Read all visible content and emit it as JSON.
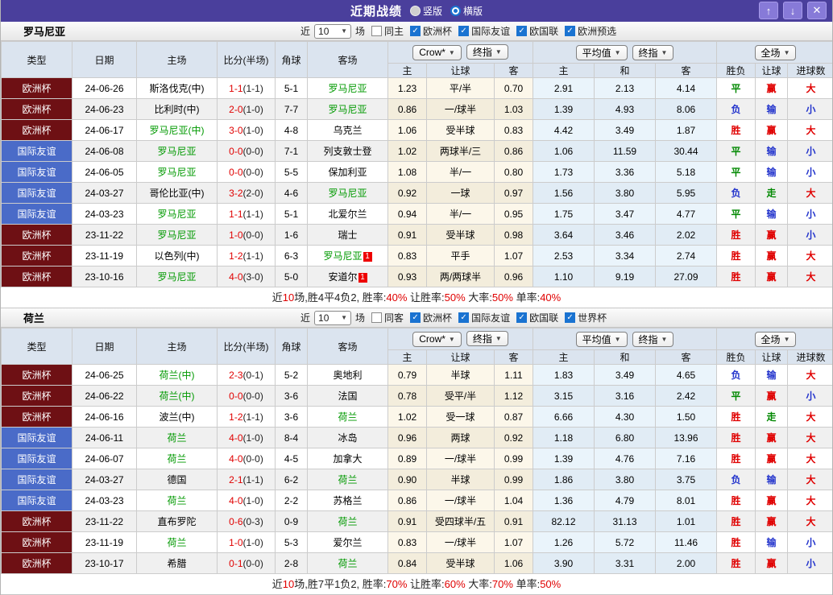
{
  "titlebar": {
    "title": "近期战绩",
    "radios": [
      {
        "label": "竖版",
        "selected": false
      },
      {
        "label": "横版",
        "selected": true
      }
    ],
    "buttons": {
      "up": "↑",
      "down": "↓",
      "close": "✕"
    }
  },
  "colors": {
    "titlebar_bg": "#4a3f9c",
    "type_euro_bg": "#6e1014",
    "type_friendly_bg": "#4a6bc8",
    "team_highlight_green": "#009900",
    "score_red": "#e00000",
    "win_red": "#e00000",
    "draw_green": "#008800",
    "lose_blue": "#2233cc",
    "crow_columns_bg": "#fcf7ea",
    "average_columns_bg": "#eaf4fb",
    "checkbox_blue": "#1a73d1"
  },
  "table_header": {
    "static_cols": [
      "类型",
      "日期",
      "主场",
      "比分(半场)",
      "角球",
      "客场"
    ],
    "odds_dropdowns": [
      "Crow*",
      "终指"
    ],
    "avg_dropdowns": [
      "平均值",
      "终指"
    ],
    "scope_dropdown": "全场",
    "sub_cols": [
      "主",
      "让球",
      "客",
      "主",
      "和",
      "客",
      "胜负",
      "让球",
      "进球数"
    ]
  },
  "sections": [
    {
      "team": "罗马尼亚",
      "filter": {
        "prefix": "近",
        "count": "10",
        "suffix": "场",
        "same": {
          "label": "同主",
          "checked": false
        },
        "leagues": [
          {
            "label": "欧洲杯",
            "checked": true
          },
          {
            "label": "国际友谊",
            "checked": true
          },
          {
            "label": "欧国联",
            "checked": true
          },
          {
            "label": "欧洲预选",
            "checked": true
          }
        ]
      },
      "rows": [
        {
          "type": "欧洲杯",
          "tk": "euro",
          "date": "24-06-26",
          "home": "斯洛伐克(中)",
          "hg": false,
          "hrc": "",
          "ft": "1-1",
          "ht": "(1-1)",
          "cor": "5-1",
          "away": "罗马尼亚",
          "ag": true,
          "arc": "",
          "o1": "1.23",
          "line": "平/半",
          "o2": "0.70",
          "a1": "2.91",
          "a2": "2.13",
          "a3": "4.14",
          "r1": "平",
          "c1": "g",
          "r2": "赢",
          "c2": "r",
          "r3": "大",
          "c3": "r"
        },
        {
          "type": "欧洲杯",
          "tk": "euro",
          "date": "24-06-23",
          "home": "比利时(中)",
          "hg": false,
          "hrc": "",
          "ft": "2-0",
          "ht": "(1-0)",
          "cor": "7-7",
          "away": "罗马尼亚",
          "ag": true,
          "arc": "",
          "o1": "0.86",
          "line": "一/球半",
          "o2": "1.03",
          "a1": "1.39",
          "a2": "4.93",
          "a3": "8.06",
          "r1": "负",
          "c1": "b",
          "r2": "输",
          "c2": "b",
          "r3": "小",
          "c3": "b"
        },
        {
          "type": "欧洲杯",
          "tk": "euro",
          "date": "24-06-17",
          "home": "罗马尼亚(中)",
          "hg": true,
          "hrc": "",
          "ft": "3-0",
          "ht": "(1-0)",
          "cor": "4-8",
          "away": "乌克兰",
          "ag": false,
          "arc": "",
          "o1": "1.06",
          "line": "受半球",
          "o2": "0.83",
          "a1": "4.42",
          "a2": "3.49",
          "a3": "1.87",
          "r1": "胜",
          "c1": "r",
          "r2": "赢",
          "c2": "r",
          "r3": "大",
          "c3": "r"
        },
        {
          "type": "国际友谊",
          "tk": "friendly",
          "date": "24-06-08",
          "home": "罗马尼亚",
          "hg": true,
          "hrc": "",
          "ft": "0-0",
          "ht": "(0-0)",
          "cor": "7-1",
          "away": "列支敦士登",
          "ag": false,
          "arc": "",
          "o1": "1.02",
          "line": "两球半/三",
          "o2": "0.86",
          "a1": "1.06",
          "a2": "11.59",
          "a3": "30.44",
          "r1": "平",
          "c1": "g",
          "r2": "输",
          "c2": "b",
          "r3": "小",
          "c3": "b"
        },
        {
          "type": "国际友谊",
          "tk": "friendly",
          "date": "24-06-05",
          "home": "罗马尼亚",
          "hg": true,
          "hrc": "",
          "ft": "0-0",
          "ht": "(0-0)",
          "cor": "5-5",
          "away": "保加利亚",
          "ag": false,
          "arc": "",
          "o1": "1.08",
          "line": "半/一",
          "o2": "0.80",
          "a1": "1.73",
          "a2": "3.36",
          "a3": "5.18",
          "r1": "平",
          "c1": "g",
          "r2": "输",
          "c2": "b",
          "r3": "小",
          "c3": "b"
        },
        {
          "type": "国际友谊",
          "tk": "friendly",
          "date": "24-03-27",
          "home": "哥伦比亚(中)",
          "hg": false,
          "hrc": "",
          "ft": "3-2",
          "ht": "(2-0)",
          "cor": "4-6",
          "away": "罗马尼亚",
          "ag": true,
          "arc": "",
          "o1": "0.92",
          "line": "一球",
          "o2": "0.97",
          "a1": "1.56",
          "a2": "3.80",
          "a3": "5.95",
          "r1": "负",
          "c1": "b",
          "r2": "走",
          "c2": "g",
          "r3": "大",
          "c3": "r"
        },
        {
          "type": "国际友谊",
          "tk": "friendly",
          "date": "24-03-23",
          "home": "罗马尼亚",
          "hg": true,
          "hrc": "",
          "ft": "1-1",
          "ht": "(1-1)",
          "cor": "5-1",
          "away": "北爱尔兰",
          "ag": false,
          "arc": "",
          "o1": "0.94",
          "line": "半/一",
          "o2": "0.95",
          "a1": "1.75",
          "a2": "3.47",
          "a3": "4.77",
          "r1": "平",
          "c1": "g",
          "r2": "输",
          "c2": "b",
          "r3": "小",
          "c3": "b"
        },
        {
          "type": "欧洲杯",
          "tk": "euro",
          "date": "23-11-22",
          "home": "罗马尼亚",
          "hg": true,
          "hrc": "",
          "ft": "1-0",
          "ht": "(0-0)",
          "cor": "1-6",
          "away": "瑞士",
          "ag": false,
          "arc": "",
          "o1": "0.91",
          "line": "受半球",
          "o2": "0.98",
          "a1": "3.64",
          "a2": "3.46",
          "a3": "2.02",
          "r1": "胜",
          "c1": "r",
          "r2": "赢",
          "c2": "r",
          "r3": "小",
          "c3": "b"
        },
        {
          "type": "欧洲杯",
          "tk": "euro",
          "date": "23-11-19",
          "home": "以色列(中)",
          "hg": false,
          "hrc": "",
          "ft": "1-2",
          "ht": "(1-1)",
          "cor": "6-3",
          "away": "罗马尼亚",
          "ag": true,
          "arc": "1",
          "o1": "0.83",
          "line": "平手",
          "o2": "1.07",
          "a1": "2.53",
          "a2": "3.34",
          "a3": "2.74",
          "r1": "胜",
          "c1": "r",
          "r2": "赢",
          "c2": "r",
          "r3": "大",
          "c3": "r"
        },
        {
          "type": "欧洲杯",
          "tk": "euro",
          "date": "23-10-16",
          "home": "罗马尼亚",
          "hg": true,
          "hrc": "",
          "ft": "4-0",
          "ht": "(3-0)",
          "cor": "5-0",
          "away": "安道尔",
          "ag": false,
          "arc": "1",
          "o1": "0.93",
          "line": "两/两球半",
          "o2": "0.96",
          "a1": "1.10",
          "a2": "9.19",
          "a3": "27.09",
          "r1": "胜",
          "c1": "r",
          "r2": "赢",
          "c2": "r",
          "r3": "大",
          "c3": "r"
        }
      ],
      "summary": [
        {
          "t": "近"
        },
        {
          "t": "10",
          "red": true
        },
        {
          "t": "场,胜4平4负2, 胜率:"
        },
        {
          "t": "40%",
          "red": true
        },
        {
          "t": " 让胜率:"
        },
        {
          "t": "50%",
          "red": true
        },
        {
          "t": " 大率:"
        },
        {
          "t": "50%",
          "red": true
        },
        {
          "t": " 单率:"
        },
        {
          "t": "40%",
          "red": true
        }
      ]
    },
    {
      "team": "荷兰",
      "filter": {
        "prefix": "近",
        "count": "10",
        "suffix": "场",
        "same": {
          "label": "同客",
          "checked": false
        },
        "leagues": [
          {
            "label": "欧洲杯",
            "checked": true
          },
          {
            "label": "国际友谊",
            "checked": true
          },
          {
            "label": "欧国联",
            "checked": true
          },
          {
            "label": "世界杯",
            "checked": true
          }
        ]
      },
      "rows": [
        {
          "type": "欧洲杯",
          "tk": "euro",
          "date": "24-06-25",
          "home": "荷兰(中)",
          "hg": true,
          "hrc": "",
          "ft": "2-3",
          "ht": "(0-1)",
          "cor": "5-2",
          "away": "奥地利",
          "ag": false,
          "arc": "",
          "o1": "0.79",
          "line": "半球",
          "o2": "1.11",
          "a1": "1.83",
          "a2": "3.49",
          "a3": "4.65",
          "r1": "负",
          "c1": "b",
          "r2": "输",
          "c2": "b",
          "r3": "大",
          "c3": "r"
        },
        {
          "type": "欧洲杯",
          "tk": "euro",
          "date": "24-06-22",
          "home": "荷兰(中)",
          "hg": true,
          "hrc": "",
          "ft": "0-0",
          "ht": "(0-0)",
          "cor": "3-6",
          "away": "法国",
          "ag": false,
          "arc": "",
          "o1": "0.78",
          "line": "受平/半",
          "o2": "1.12",
          "a1": "3.15",
          "a2": "3.16",
          "a3": "2.42",
          "r1": "平",
          "c1": "g",
          "r2": "赢",
          "c2": "r",
          "r3": "小",
          "c3": "b"
        },
        {
          "type": "欧洲杯",
          "tk": "euro",
          "date": "24-06-16",
          "home": "波兰(中)",
          "hg": false,
          "hrc": "",
          "ft": "1-2",
          "ht": "(1-1)",
          "cor": "3-6",
          "away": "荷兰",
          "ag": true,
          "arc": "",
          "o1": "1.02",
          "line": "受一球",
          "o2": "0.87",
          "a1": "6.66",
          "a2": "4.30",
          "a3": "1.50",
          "r1": "胜",
          "c1": "r",
          "r2": "走",
          "c2": "g",
          "r3": "大",
          "c3": "r"
        },
        {
          "type": "国际友谊",
          "tk": "friendly",
          "date": "24-06-11",
          "home": "荷兰",
          "hg": true,
          "hrc": "",
          "ft": "4-0",
          "ht": "(1-0)",
          "cor": "8-4",
          "away": "冰岛",
          "ag": false,
          "arc": "",
          "o1": "0.96",
          "line": "两球",
          "o2": "0.92",
          "a1": "1.18",
          "a2": "6.80",
          "a3": "13.96",
          "r1": "胜",
          "c1": "r",
          "r2": "赢",
          "c2": "r",
          "r3": "大",
          "c3": "r"
        },
        {
          "type": "国际友谊",
          "tk": "friendly",
          "date": "24-06-07",
          "home": "荷兰",
          "hg": true,
          "hrc": "",
          "ft": "4-0",
          "ht": "(0-0)",
          "cor": "4-5",
          "away": "加拿大",
          "ag": false,
          "arc": "",
          "o1": "0.89",
          "line": "一/球半",
          "o2": "0.99",
          "a1": "1.39",
          "a2": "4.76",
          "a3": "7.16",
          "r1": "胜",
          "c1": "r",
          "r2": "赢",
          "c2": "r",
          "r3": "大",
          "c3": "r"
        },
        {
          "type": "国际友谊",
          "tk": "friendly",
          "date": "24-03-27",
          "home": "德国",
          "hg": false,
          "hrc": "",
          "ft": "2-1",
          "ht": "(1-1)",
          "cor": "6-2",
          "away": "荷兰",
          "ag": true,
          "arc": "",
          "o1": "0.90",
          "line": "半球",
          "o2": "0.99",
          "a1": "1.86",
          "a2": "3.80",
          "a3": "3.75",
          "r1": "负",
          "c1": "b",
          "r2": "输",
          "c2": "b",
          "r3": "大",
          "c3": "r"
        },
        {
          "type": "国际友谊",
          "tk": "friendly",
          "date": "24-03-23",
          "home": "荷兰",
          "hg": true,
          "hrc": "",
          "ft": "4-0",
          "ht": "(1-0)",
          "cor": "2-2",
          "away": "苏格兰",
          "ag": false,
          "arc": "",
          "o1": "0.86",
          "line": "一/球半",
          "o2": "1.04",
          "a1": "1.36",
          "a2": "4.79",
          "a3": "8.01",
          "r1": "胜",
          "c1": "r",
          "r2": "赢",
          "c2": "r",
          "r3": "大",
          "c3": "r"
        },
        {
          "type": "欧洲杯",
          "tk": "euro",
          "date": "23-11-22",
          "home": "直布罗陀",
          "hg": false,
          "hrc": "",
          "ft": "0-6",
          "ht": "(0-3)",
          "cor": "0-9",
          "away": "荷兰",
          "ag": true,
          "arc": "",
          "o1": "0.91",
          "line": "受四球半/五",
          "o2": "0.91",
          "a1": "82.12",
          "a2": "31.13",
          "a3": "1.01",
          "r1": "胜",
          "c1": "r",
          "r2": "赢",
          "c2": "r",
          "r3": "大",
          "c3": "r"
        },
        {
          "type": "欧洲杯",
          "tk": "euro",
          "date": "23-11-19",
          "home": "荷兰",
          "hg": true,
          "hrc": "",
          "ft": "1-0",
          "ht": "(1-0)",
          "cor": "5-3",
          "away": "爱尔兰",
          "ag": false,
          "arc": "",
          "o1": "0.83",
          "line": "一/球半",
          "o2": "1.07",
          "a1": "1.26",
          "a2": "5.72",
          "a3": "11.46",
          "r1": "胜",
          "c1": "r",
          "r2": "输",
          "c2": "b",
          "r3": "小",
          "c3": "b"
        },
        {
          "type": "欧洲杯",
          "tk": "euro",
          "date": "23-10-17",
          "home": "希腊",
          "hg": false,
          "hrc": "",
          "ft": "0-1",
          "ht": "(0-0)",
          "cor": "2-8",
          "away": "荷兰",
          "ag": true,
          "arc": "",
          "o1": "0.84",
          "line": "受半球",
          "o2": "1.06",
          "a1": "3.90",
          "a2": "3.31",
          "a3": "2.00",
          "r1": "胜",
          "c1": "r",
          "r2": "赢",
          "c2": "r",
          "r3": "小",
          "c3": "b"
        }
      ],
      "summary": [
        {
          "t": "近"
        },
        {
          "t": "10",
          "red": true
        },
        {
          "t": "场,胜7平1负2, 胜率:"
        },
        {
          "t": "70%",
          "red": true
        },
        {
          "t": " 让胜率:"
        },
        {
          "t": "60%",
          "red": true
        },
        {
          "t": " 大率:"
        },
        {
          "t": "70%",
          "red": true
        },
        {
          "t": " 单率:"
        },
        {
          "t": "50%",
          "red": true
        }
      ]
    }
  ]
}
